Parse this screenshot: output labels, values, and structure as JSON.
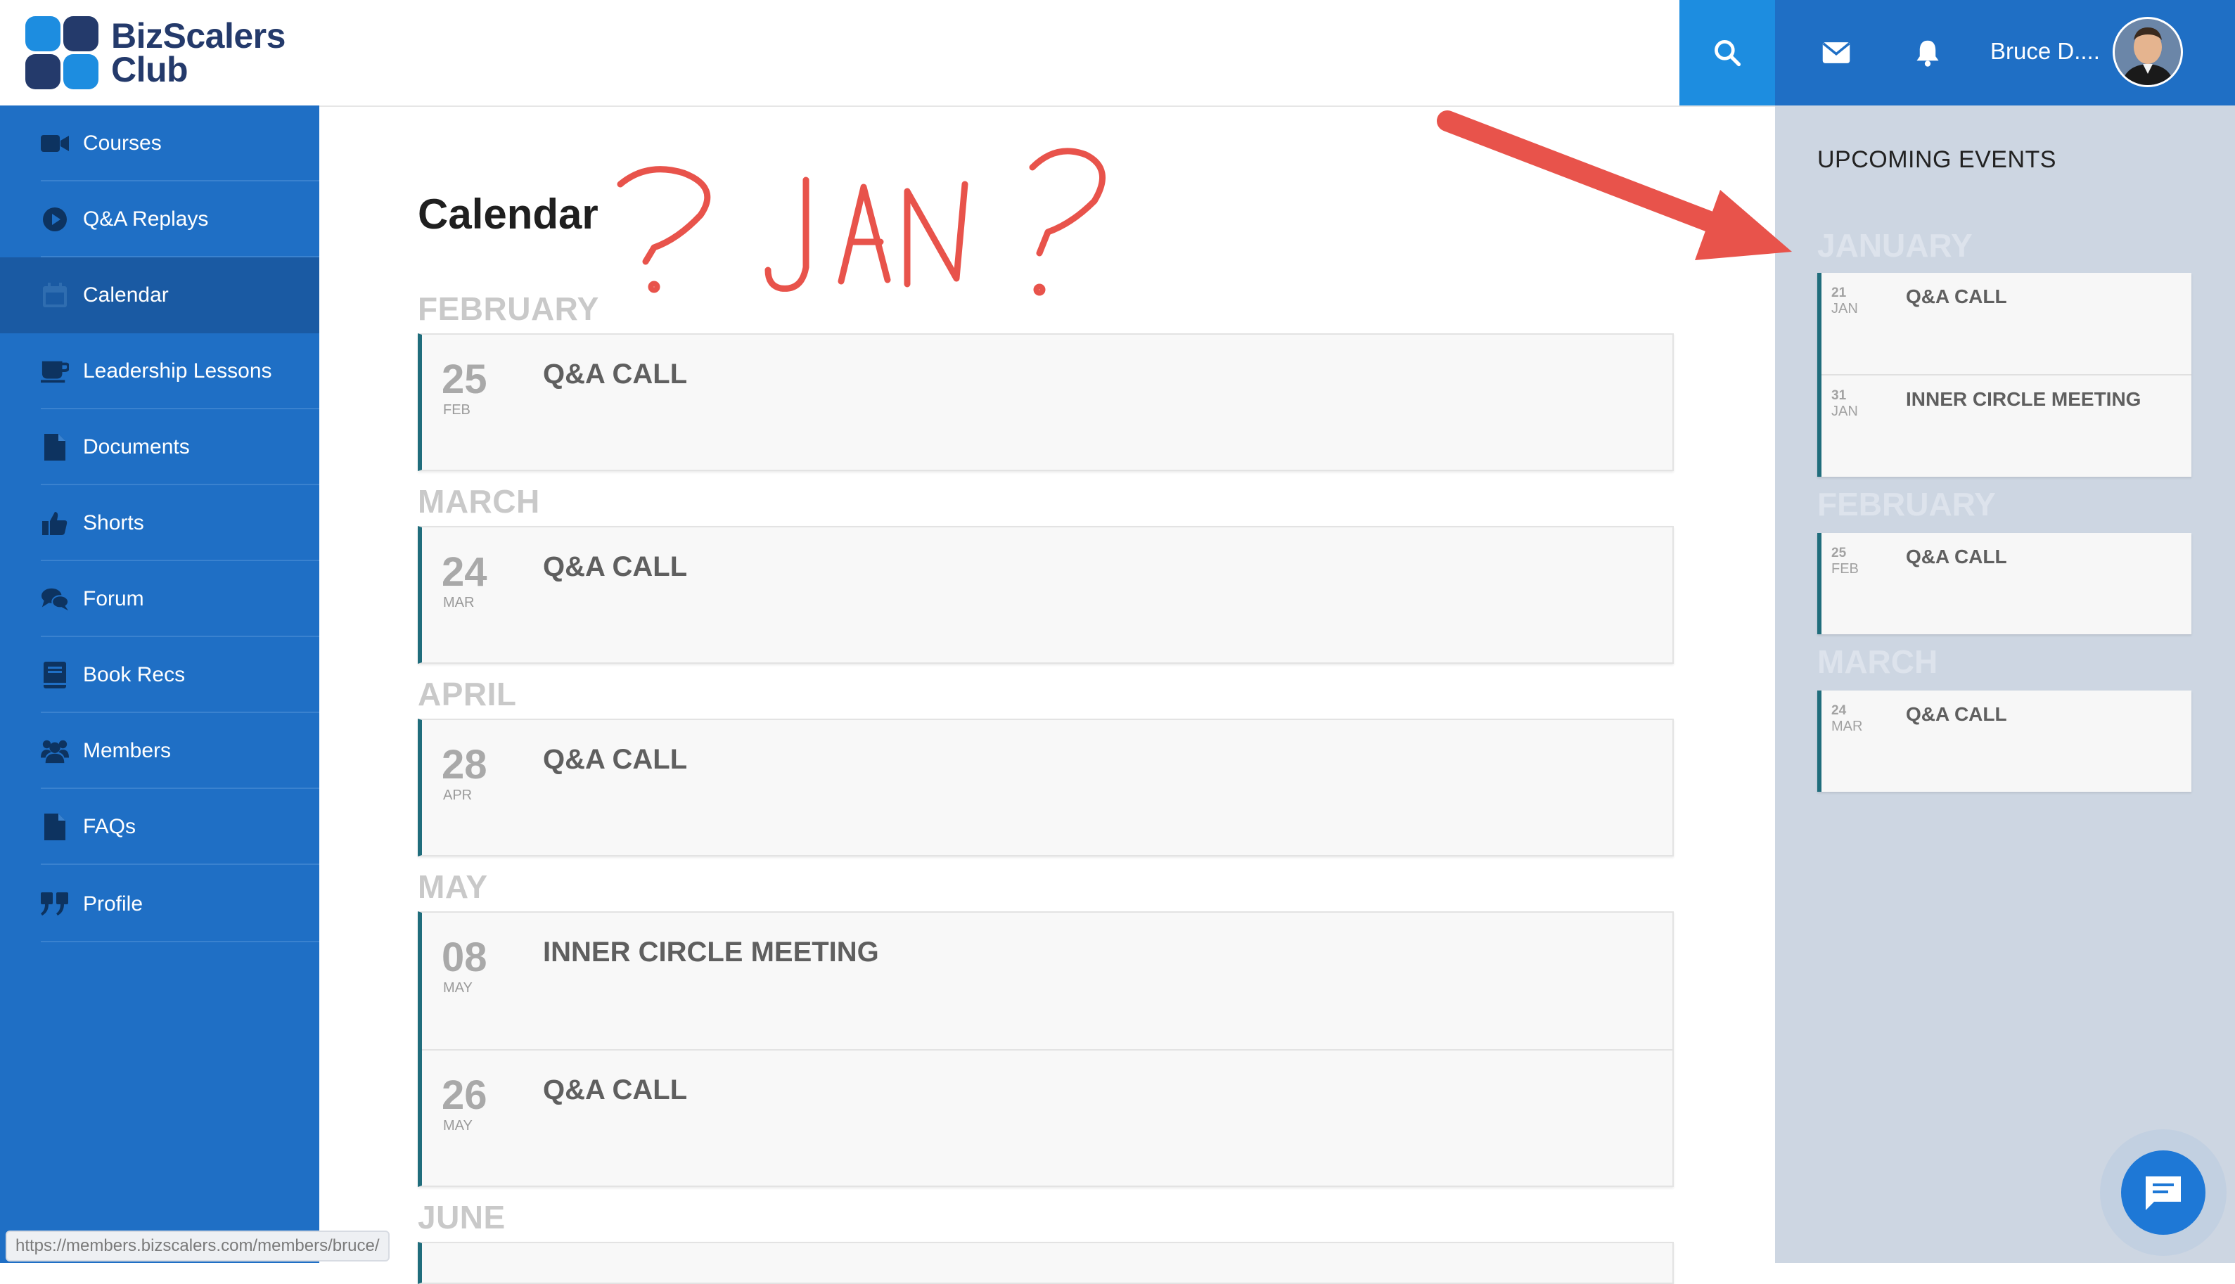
{
  "brand": {
    "name_line1": "BizScalers",
    "name_line2": "Club"
  },
  "header": {
    "user_name": "Bruce D...."
  },
  "icons": {
    "search": "search-icon",
    "mail": "mail-icon",
    "bell": "bell-icon",
    "chat": "chat-icon",
    "courses": "video-camera-icon",
    "qa_replays": "play-circle-icon",
    "calendar": "calendar-icon",
    "leadership": "coffee-cup-icon",
    "documents": "document-icon",
    "shorts": "thumbs-up-icon",
    "forum": "chat-bubbles-icon",
    "book_recs": "book-icon",
    "members": "users-icon",
    "faqs": "file-icon",
    "profile": "quote-icon"
  },
  "colors": {
    "header_blue": "#1f6fc5",
    "search_blue": "#1d8de0",
    "active_nav": "#1a5aa3",
    "card_accent": "#206d7c",
    "right_panel": "#cdd6e2",
    "annotation_red": "#e8534b"
  },
  "sidebar": {
    "items": [
      {
        "label": "Courses"
      },
      {
        "label": "Q&A Replays"
      },
      {
        "label": "Calendar"
      },
      {
        "label": "Leadership Lessons"
      },
      {
        "label": "Documents"
      },
      {
        "label": "Shorts"
      },
      {
        "label": "Forum"
      },
      {
        "label": "Book Recs"
      },
      {
        "label": "Members"
      },
      {
        "label": "FAQs"
      },
      {
        "label": "Profile"
      }
    ],
    "active_index": 2
  },
  "main": {
    "title": "Calendar",
    "months": [
      {
        "name": "FEBRUARY",
        "events": [
          {
            "day": "25",
            "mon": "FEB",
            "title": "Q&A CALL"
          }
        ]
      },
      {
        "name": "MARCH",
        "events": [
          {
            "day": "24",
            "mon": "MAR",
            "title": "Q&A CALL"
          }
        ]
      },
      {
        "name": "APRIL",
        "events": [
          {
            "day": "28",
            "mon": "APR",
            "title": "Q&A CALL"
          }
        ]
      },
      {
        "name": "MAY",
        "events": [
          {
            "day": "08",
            "mon": "MAY",
            "title": "INNER CIRCLE MEETING"
          },
          {
            "day": "26",
            "mon": "MAY",
            "title": "Q&A CALL"
          }
        ]
      },
      {
        "name": "JUNE",
        "events": []
      }
    ]
  },
  "upcoming": {
    "title": "UPCOMING EVENTS",
    "months": [
      {
        "name": "JANUARY",
        "events": [
          {
            "day": "21",
            "mon": "JAN",
            "title": "Q&A CALL"
          },
          {
            "day": "31",
            "mon": "JAN",
            "title": "INNER CIRCLE MEETING"
          }
        ]
      },
      {
        "name": "FEBRUARY",
        "events": [
          {
            "day": "25",
            "mon": "FEB",
            "title": "Q&A CALL"
          }
        ]
      },
      {
        "name": "MARCH",
        "events": [
          {
            "day": "24",
            "mon": "MAR",
            "title": "Q&A CALL"
          }
        ]
      }
    ]
  },
  "status_bar": {
    "url": "https://members.bizscalers.com/members/bruce/"
  },
  "annotation": {
    "text": "? JAN ?"
  }
}
